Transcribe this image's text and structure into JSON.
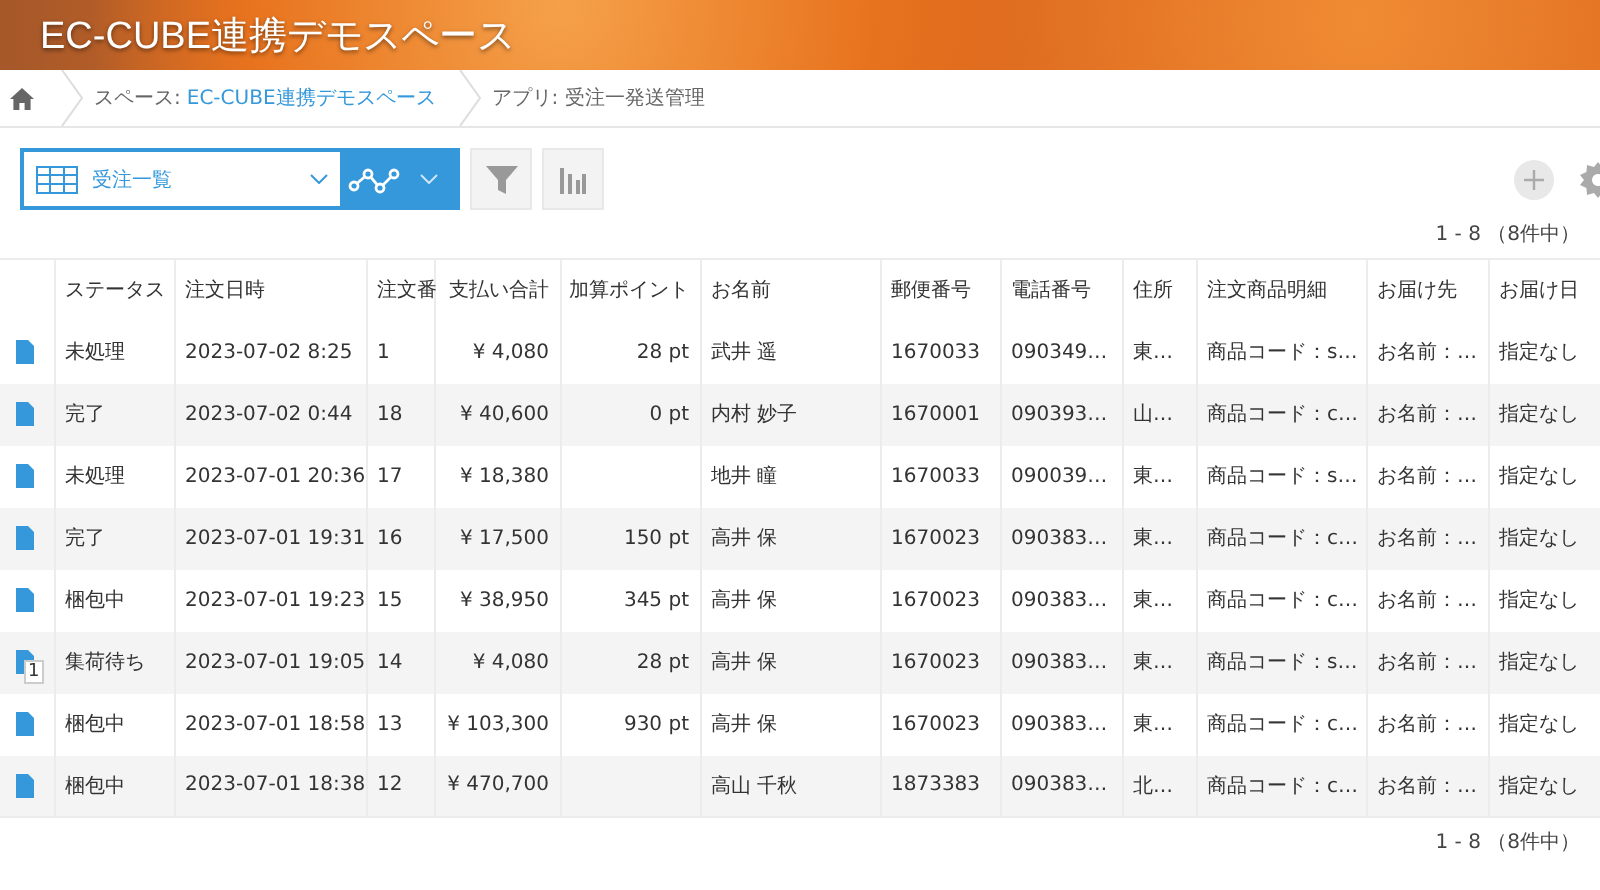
{
  "header": {
    "title": "EC-CUBE連携デモスペース"
  },
  "breadcrumb": {
    "space_label": "スペース:",
    "space_name": "EC-CUBE連携デモスペース",
    "app": "アプリ: 受注一発送管理"
  },
  "toolbar": {
    "view": "受注一覧"
  },
  "pager_top": "1 - 8 （8件中）",
  "table": {
    "columns": [
      {
        "label": "ステータス"
      },
      {
        "label": "注文日時"
      },
      {
        "label": "注文番"
      },
      {
        "label": "支払い合計"
      },
      {
        "label": "加算ポイント"
      },
      {
        "label": "お名前"
      },
      {
        "label": "郵便番号"
      },
      {
        "label": "電話番号"
      },
      {
        "label": "住所"
      },
      {
        "label": "注文商品明細"
      },
      {
        "label": "お届け先"
      },
      {
        "label": "お届け日"
      }
    ],
    "rows": [
      {
        "cells": [
          "未処理",
          "2023-07-02 8:25",
          "1",
          "¥ 4,080",
          "28 pt",
          "武井 遥",
          "1670033",
          "090349…",
          "東…",
          "商品コード：s…",
          "お名前：…",
          "指定なし"
        ]
      },
      {
        "cells": [
          "完了",
          "2023-07-02 0:44",
          "18",
          "¥ 40,600",
          "0 pt",
          "内村 妙子",
          "1670001",
          "090393…",
          "山…",
          "商品コード：c…",
          "お名前：…",
          "指定なし"
        ]
      },
      {
        "cells": [
          "未処理",
          "2023-07-01 20:36",
          "17",
          "¥ 18,380",
          null,
          "地井 瞳",
          "1670033",
          "090039…",
          "東…",
          "商品コード：s…",
          "お名前：…",
          "指定なし"
        ]
      },
      {
        "cells": [
          "完了",
          "2023-07-01 19:31",
          "16",
          "¥ 17,500",
          "150 pt",
          "高井 保",
          "1670023",
          "090383…",
          "東…",
          "商品コード：c…",
          "お名前：…",
          "指定なし"
        ]
      },
      {
        "cells": [
          "梱包中",
          "2023-07-01 19:23",
          "15",
          "¥ 38,950",
          "345 pt",
          "高井 保",
          "1670023",
          "090383…",
          "東…",
          "商品コード：c…",
          "お名前：…",
          "指定なし"
        ]
      },
      {
        "comments": "1",
        "cells": [
          "集荷待ち",
          "2023-07-01 19:05",
          "14",
          "¥ 4,080",
          "28 pt",
          "高井 保",
          "1670023",
          "090383…",
          "東…",
          "商品コード：s…",
          "お名前：…",
          "指定なし"
        ]
      },
      {
        "cells": [
          "梱包中",
          "2023-07-01 18:58",
          "13",
          "¥ 103,300",
          "930 pt",
          "高井 保",
          "1670023",
          "090383…",
          "東…",
          "商品コード：c…",
          "お名前：…",
          "指定なし"
        ]
      },
      {
        "cells": [
          "梱包中",
          "2023-07-01 18:38",
          "12",
          "¥ 470,700",
          null,
          "高山 千秋",
          "1873383",
          "090383…",
          "北…",
          "商品コード：c…",
          "お名前：…",
          "指定なし"
        ]
      }
    ]
  },
  "pager_bottom": "1 - 8 （8件中）"
}
